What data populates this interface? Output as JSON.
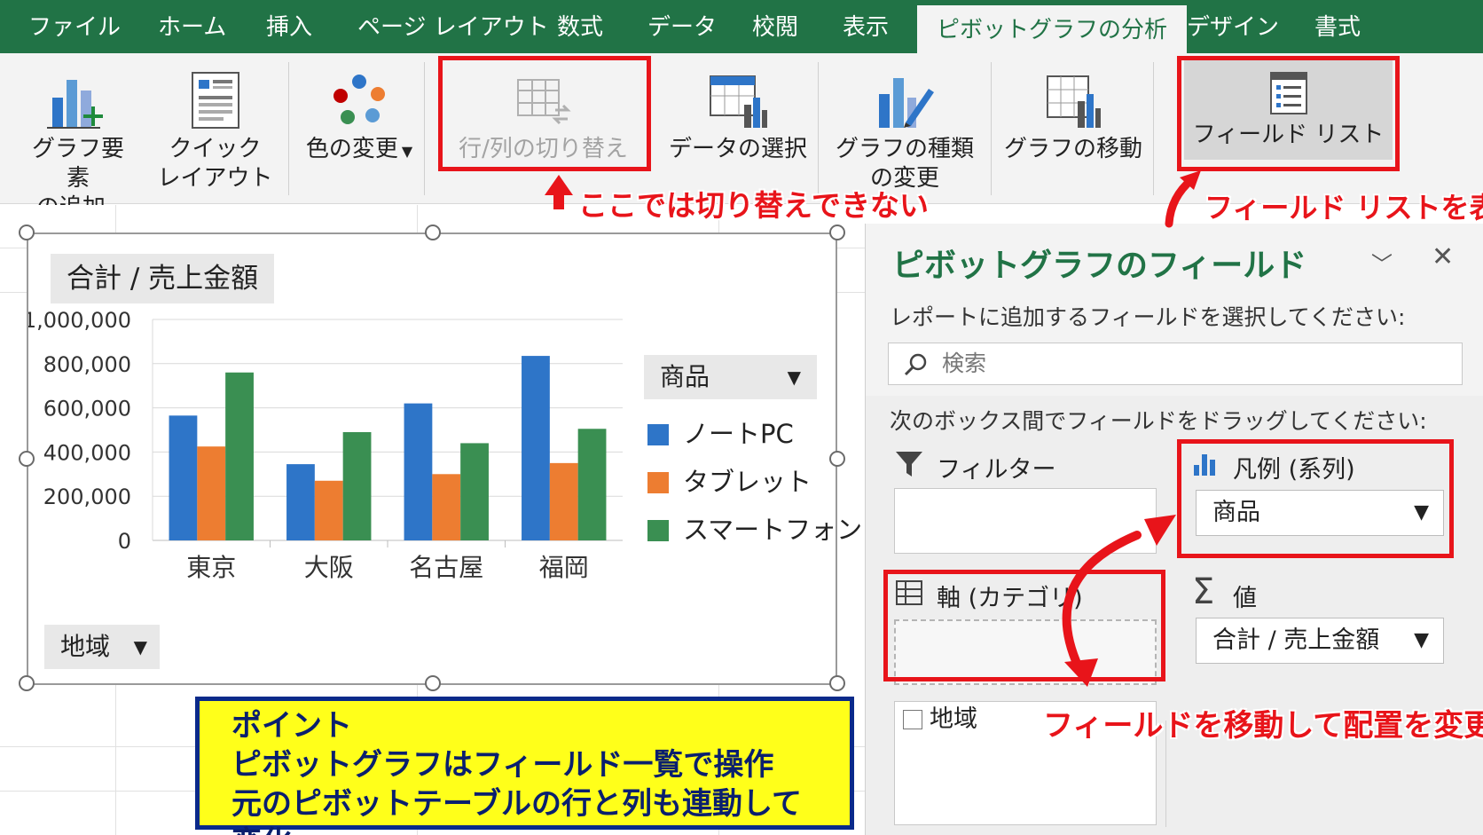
{
  "tabs": [
    "ファイル",
    "ホーム",
    "挿入",
    "ページ レイアウト",
    "数式",
    "データ",
    "校閲",
    "表示",
    "ピボットグラフの分析",
    "デザイン",
    "書式"
  ],
  "ribbon": {
    "add_element": [
      "グラフ要素",
      "の追加"
    ],
    "quick_layout": [
      "クイック",
      "レイアウト"
    ],
    "change_colors": "色の変更",
    "switch_row_col": "行/列の切り替え",
    "select_data": "データの選択",
    "change_type": [
      "グラフの種類",
      "の変更"
    ],
    "move_chart": "グラフの移動",
    "field_list": "フィールド リスト"
  },
  "chart": {
    "value_button": "合計 / 売上金額",
    "axis_button": "地域",
    "legend_button": "商品"
  },
  "chart_data": {
    "type": "bar",
    "title": "",
    "categories": [
      "東京",
      "大阪",
      "名古屋",
      "福岡"
    ],
    "series": [
      {
        "name": "ノートPC",
        "values": [
          565000,
          345000,
          620000,
          835000
        ],
        "color": "#2e75c8"
      },
      {
        "name": "タブレット",
        "values": [
          425000,
          270000,
          300000,
          350000
        ],
        "color": "#ed7d31"
      },
      {
        "name": "スマートフォン",
        "values": [
          760000,
          490000,
          440000,
          505000
        ],
        "color": "#3a8f52"
      }
    ],
    "ylim": [
      0,
      1000000
    ],
    "yticks": [
      "1,000,000",
      "800,000",
      "600,000",
      "400,000",
      "200,000",
      "0"
    ],
    "grid": true,
    "legend": "right"
  },
  "pane": {
    "title": "ピボットグラフのフィールド",
    "instruction": "レポートに追加するフィールドを選択してください:",
    "search_placeholder": "検索",
    "drag_instruction": "次のボックス間でフィールドをドラッグしてください:",
    "filter_label": "フィルター",
    "legend_label": "凡例 (系列)",
    "legend_value": "商品",
    "axis_label": "軸 (カテゴリ)",
    "values_label": "値",
    "values_value": "合計 / 売上金額",
    "field_region": "地域"
  },
  "annotations": {
    "cannot_switch": "ここでは切り替えできない",
    "show_field_list": "フィールド リストを表示",
    "move_fields": "フィールドを移動して配置を変更"
  },
  "note": {
    "title": "ポイント",
    "line1": "ピボットグラフはフィールド一覧で操作",
    "line2": "元のピボットテーブルの行と列も連動して変化"
  },
  "colors": {
    "accent": "#217346",
    "annotation": "#e8141a",
    "note_bg": "#ffff1a",
    "note_border": "#0a2a8a"
  }
}
